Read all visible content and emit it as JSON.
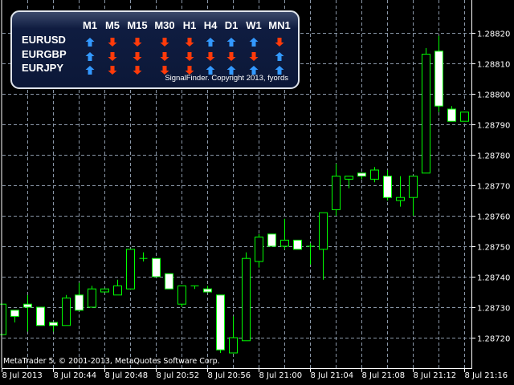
{
  "signal_panel": {
    "columns": [
      "M1",
      "M5",
      "M15",
      "M30",
      "H1",
      "H4",
      "D1",
      "W1",
      "MN1"
    ],
    "rows": [
      {
        "symbol": "EURUSD",
        "signals": [
          "up",
          "down",
          "down",
          "down",
          "down",
          "up",
          "up",
          "up",
          "down"
        ]
      },
      {
        "symbol": "EURGBP",
        "signals": [
          "up",
          "down",
          "down",
          "down",
          "down",
          "down",
          "down",
          "down",
          "up"
        ]
      },
      {
        "symbol": "EURJPY",
        "signals": [
          "up",
          "down",
          "down",
          "down",
          "down",
          "up",
          "up",
          "up",
          "up"
        ]
      }
    ],
    "copyright": "SignalFinder. Copyright 2013, fyords",
    "colors": {
      "up": "#3399ff",
      "down": "#ff3a0a"
    }
  },
  "footer": "MetaTrader 5, © 2001-2013, MetaQuotes Software Corp.",
  "chart_data": {
    "type": "candlestick",
    "symbol_timeframe": "M1",
    "ylim": [
      1.28709,
      1.28831
    ],
    "price_ticks": [
      "1.28820",
      "1.28810",
      "1.28800",
      "1.28790",
      "1.28780",
      "1.28770",
      "1.28760",
      "1.28750",
      "1.28740",
      "1.28730",
      "1.28720"
    ],
    "time_ticks": [
      "8 Jul 2013",
      "8 Jul 20:44",
      "8 Jul 20:48",
      "8 Jul 20:52",
      "8 Jul 20:56",
      "8 Jul 21:00",
      "8 Jul 21:04",
      "8 Jul 21:08",
      "8 Jul 21:12",
      "8 Jul 21:16"
    ],
    "bull_color": "#00ff00",
    "bear_fill": "#ffffff",
    "grid_color": "#8a97a8",
    "candles": [
      {
        "t": "20:40",
        "o": 1.28721,
        "h": 1.28731,
        "l": 1.28721,
        "c": 1.28731
      },
      {
        "t": "20:41",
        "o": 1.28729,
        "h": 1.28729,
        "l": 1.28725,
        "c": 1.28727
      },
      {
        "t": "20:42",
        "o": 1.28731,
        "h": 1.28734,
        "l": 1.28722,
        "c": 1.2873
      },
      {
        "t": "20:43",
        "o": 1.2873,
        "h": 1.2873,
        "l": 1.28724,
        "c": 1.28724
      },
      {
        "t": "20:44",
        "o": 1.28725,
        "h": 1.28725,
        "l": 1.28722,
        "c": 1.28724
      },
      {
        "t": "20:45",
        "o": 1.28724,
        "h": 1.28734,
        "l": 1.28724,
        "c": 1.28733
      },
      {
        "t": "20:46",
        "o": 1.28734,
        "h": 1.28738,
        "l": 1.28729,
        "c": 1.28729
      },
      {
        "t": "20:47",
        "o": 1.2873,
        "h": 1.28737,
        "l": 1.2873,
        "c": 1.28736
      },
      {
        "t": "20:48",
        "o": 1.28735,
        "h": 1.28736,
        "l": 1.28735,
        "c": 1.28736
      },
      {
        "t": "20:49",
        "o": 1.28734,
        "h": 1.28739,
        "l": 1.28734,
        "c": 1.28737
      },
      {
        "t": "20:50",
        "o": 1.28736,
        "h": 1.28749,
        "l": 1.28736,
        "c": 1.28749
      },
      {
        "t": "20:51",
        "o": 1.28746,
        "h": 1.28748,
        "l": 1.28745,
        "c": 1.28746
      },
      {
        "t": "20:52",
        "o": 1.28746,
        "h": 1.28746,
        "l": 1.2874,
        "c": 1.2874
      },
      {
        "t": "20:53",
        "o": 1.28741,
        "h": 1.28741,
        "l": 1.28736,
        "c": 1.28736
      },
      {
        "t": "20:54",
        "o": 1.28731,
        "h": 1.28737,
        "l": 1.2873,
        "c": 1.28737
      },
      {
        "t": "20:55",
        "o": 1.28737,
        "h": 1.28737,
        "l": 1.28736,
        "c": 1.28737
      },
      {
        "t": "20:56",
        "o": 1.28736,
        "h": 1.28737,
        "l": 1.28735,
        "c": 1.28735
      },
      {
        "t": "20:57",
        "o": 1.28734,
        "h": 1.28734,
        "l": 1.28715,
        "c": 1.28716
      },
      {
        "t": "20:58",
        "o": 1.28715,
        "h": 1.28727,
        "l": 1.28715,
        "c": 1.2872
      },
      {
        "t": "20:59",
        "o": 1.28719,
        "h": 1.28748,
        "l": 1.28719,
        "c": 1.28746
      },
      {
        "t": "21:00",
        "o": 1.28745,
        "h": 1.28754,
        "l": 1.28743,
        "c": 1.28753
      },
      {
        "t": "21:01",
        "o": 1.28754,
        "h": 1.28754,
        "l": 1.2875,
        "c": 1.2875
      },
      {
        "t": "21:02",
        "o": 1.2875,
        "h": 1.28759,
        "l": 1.28749,
        "c": 1.28752
      },
      {
        "t": "21:03",
        "o": 1.28752,
        "h": 1.28752,
        "l": 1.28749,
        "c": 1.28749
      },
      {
        "t": "21:04",
        "o": 1.2875,
        "h": 1.28751,
        "l": 1.28744,
        "c": 1.2875
      },
      {
        "t": "21:05",
        "o": 1.28749,
        "h": 1.28761,
        "l": 1.28739,
        "c": 1.28761
      },
      {
        "t": "21:06",
        "o": 1.28762,
        "h": 1.28777,
        "l": 1.2876,
        "c": 1.28773
      },
      {
        "t": "21:07",
        "o": 1.28772,
        "h": 1.28773,
        "l": 1.28769,
        "c": 1.28773
      },
      {
        "t": "21:08",
        "o": 1.28774,
        "h": 1.28774,
        "l": 1.28772,
        "c": 1.28773
      },
      {
        "t": "21:09",
        "o": 1.28772,
        "h": 1.28776,
        "l": 1.28771,
        "c": 1.28775
      },
      {
        "t": "21:10",
        "o": 1.28773,
        "h": 1.28775,
        "l": 1.28765,
        "c": 1.28766
      },
      {
        "t": "21:11",
        "o": 1.28765,
        "h": 1.28773,
        "l": 1.28763,
        "c": 1.28766
      },
      {
        "t": "21:12",
        "o": 1.28766,
        "h": 1.28773,
        "l": 1.2876,
        "c": 1.28773
      },
      {
        "t": "21:13",
        "o": 1.28774,
        "h": 1.28815,
        "l": 1.28774,
        "c": 1.28813
      },
      {
        "t": "21:14",
        "o": 1.28814,
        "h": 1.28819,
        "l": 1.28794,
        "c": 1.28796
      },
      {
        "t": "21:15",
        "o": 1.28795,
        "h": 1.28796,
        "l": 1.28791,
        "c": 1.28791
      },
      {
        "t": "21:16",
        "o": 1.28791,
        "h": 1.28794,
        "l": 1.28791,
        "c": 1.28794
      }
    ]
  }
}
